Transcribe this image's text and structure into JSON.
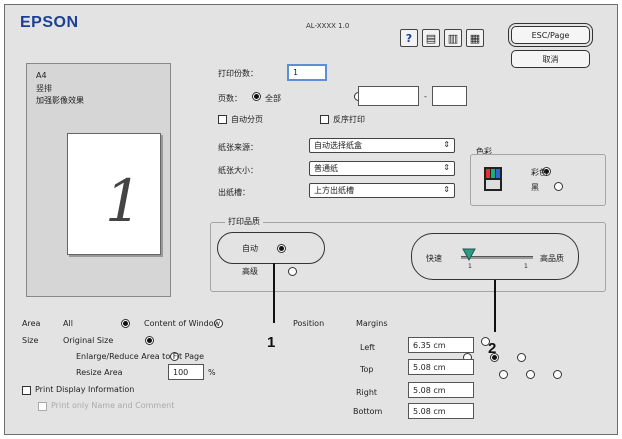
{
  "header": {
    "logo": "EPSON",
    "model": "AL-XXXX 1.0",
    "icons": {
      "help": "?",
      "doc1": "▤",
      "doc2": "▥",
      "doc3": "▦"
    },
    "esc_page_label": "ESC/Page",
    "cancel_label": "取消"
  },
  "preview": {
    "paper_size": "A4",
    "orientation": "竖排",
    "note": "加强影像效果",
    "page_number": "1"
  },
  "copies": {
    "label": "打印份数：",
    "value": "1"
  },
  "pages": {
    "label": "页数：",
    "all_label": "全部",
    "from": "",
    "to": "",
    "dash": "-"
  },
  "checkboxes": {
    "collate": "自动分页",
    "reverse": "反序打印"
  },
  "popups": {
    "paper_source": {
      "label": "纸张来源：",
      "value": "自动选择纸盒"
    },
    "paper_size": {
      "label": "纸张大小：",
      "value": "普通纸"
    },
    "output_tray": {
      "label": "出纸槽：",
      "value": "上方出纸槽"
    }
  },
  "color": {
    "title": "色彩",
    "color_option": "彩色",
    "bw_option": "黑"
  },
  "quality": {
    "title": "打印品质",
    "auto_label": "自动",
    "advanced_label": "高级",
    "fast_label": "快速",
    "quality_label": "高品质",
    "tick_left": "1",
    "tick_right": "1"
  },
  "area": {
    "label": "Area",
    "all_label": "All",
    "window_label": "Content of Window"
  },
  "size": {
    "label": "Size",
    "original_label": "Original Size",
    "enlarge_label": "Enlarge/Reduce Area to Fit Page",
    "resize_label": "Resize Area",
    "resize_value": "100",
    "resize_unit": "%"
  },
  "print_display": "Print Display Information",
  "print_name_only": "Print only Name and Comment",
  "position": {
    "label": "Position"
  },
  "margins": {
    "label": "Margins",
    "left_label": "Left",
    "left_value": "6.35 cm",
    "top_label": "Top",
    "top_value": "5.08 cm",
    "right_label": "Right",
    "right_value": "5.08 cm",
    "bottom_label": "Bottom",
    "bottom_value": "5.08 cm"
  },
  "callouts": {
    "one": "1",
    "two": "2"
  }
}
